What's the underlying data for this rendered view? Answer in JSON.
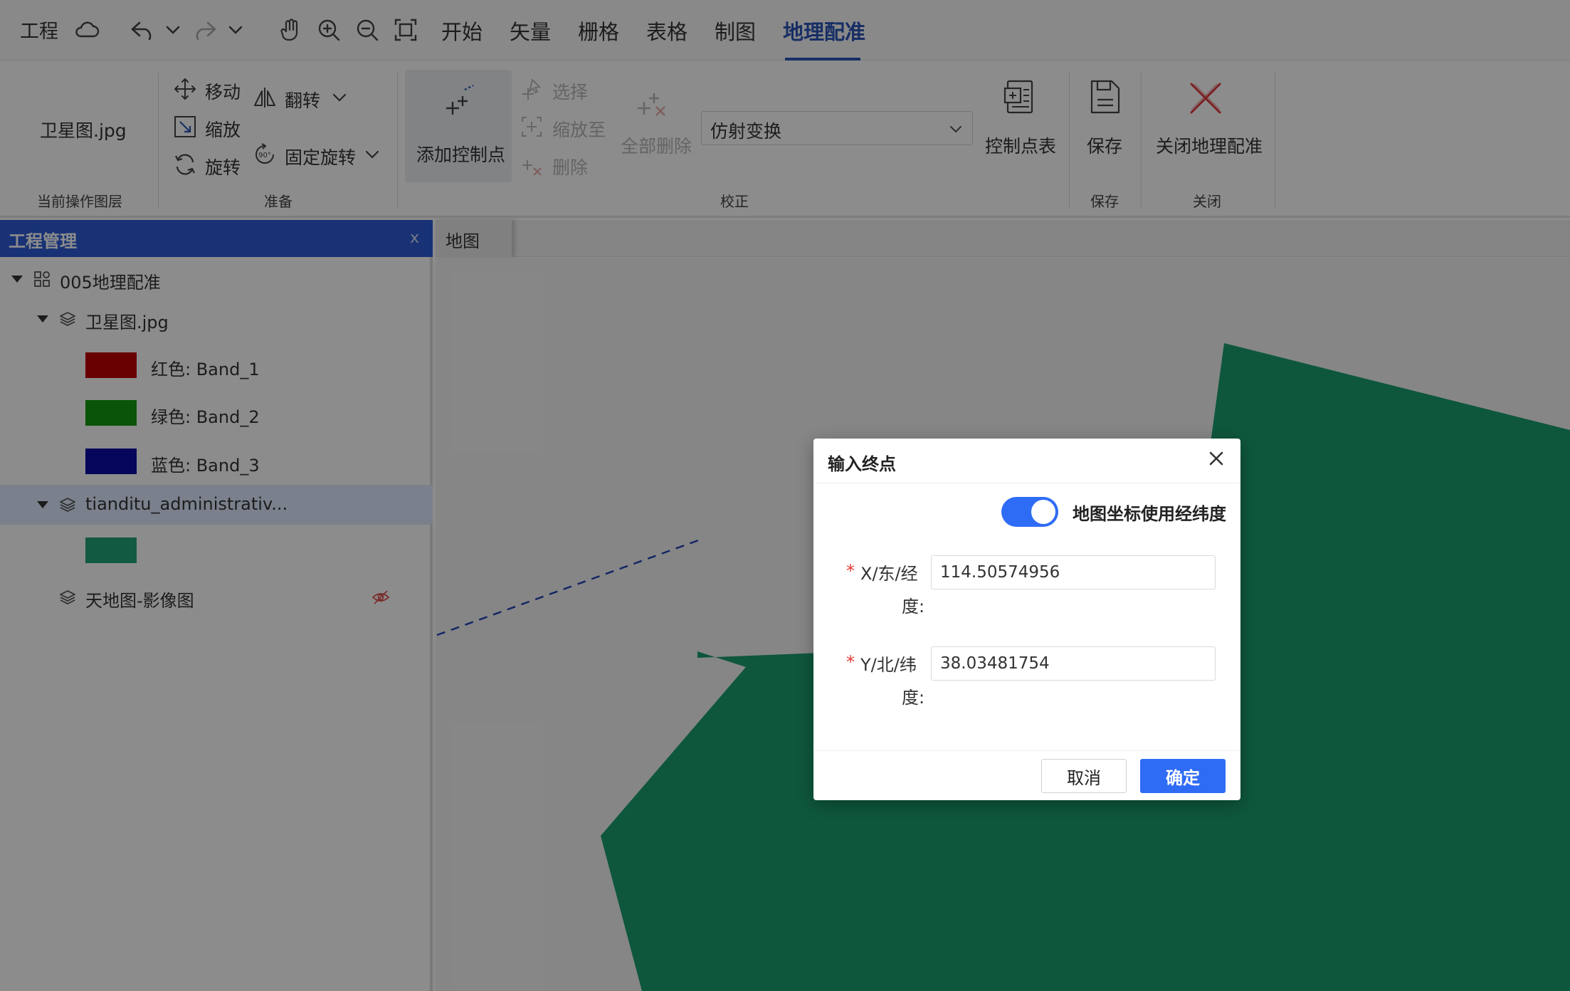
{
  "colors": {
    "accent": "#2a54b8",
    "panel_header": "#2f5bd6",
    "toggle_on": "#2f6cf5",
    "map_polygon": "#1a9e6e",
    "required": "#e53935"
  },
  "menubar": {
    "project": "工程",
    "tabs": [
      {
        "label": "开始",
        "active": false
      },
      {
        "label": "矢量",
        "active": false
      },
      {
        "label": "栅格",
        "active": false
      },
      {
        "label": "表格",
        "active": false
      },
      {
        "label": "制图",
        "active": false
      },
      {
        "label": "地理配准",
        "active": true
      }
    ],
    "icons": [
      "cloud-icon",
      "undo-icon",
      "chevron-down-icon",
      "redo-icon",
      "chevron-down-icon",
      "hand-icon",
      "zoom-in-icon",
      "zoom-out-icon",
      "fit-extent-icon"
    ]
  },
  "ribbon": {
    "current_layer": {
      "value": "卫星图.jpg",
      "group": "当前操作图层"
    },
    "prepare": {
      "move": "移动",
      "scale": "缩放",
      "rotate": "旋转",
      "flip": "翻转",
      "fixed_rotate": "固定旋转",
      "group": "准备"
    },
    "correct": {
      "add_point": "添加控制点",
      "select": "选择",
      "zoom_to": "缩放至",
      "delete": "删除",
      "delete_all": "全部删除",
      "transform_selected": "仿射变换",
      "table": "控制点表",
      "group": "校正"
    },
    "save": {
      "label": "保存",
      "group": "保存"
    },
    "close": {
      "label": "关闭地理配准",
      "group": "关闭"
    }
  },
  "panel": {
    "title": "工程管理",
    "close": "x",
    "tree": {
      "root": "005地理配准",
      "layer1": "卫星图.jpg",
      "band1": "红色: Band_1",
      "band2": "绿色: Band_2",
      "band3": "蓝色: Band_3",
      "layer2": "tianditu_administrativ...",
      "layer3": "天地图-影像图"
    },
    "swatches": {
      "red": "#c00000",
      "green": "#119a11",
      "blue": "#0a0aa5",
      "teal": "#23a57a"
    }
  },
  "map": {
    "tab": "地图"
  },
  "dialog": {
    "title": "输入终点",
    "toggle_label": "地图坐标使用经纬度",
    "toggle_on": true,
    "x_label_line1": "X/东/经",
    "x_label_line2": "度:",
    "x_value": "114.50574956",
    "y_label_line1": "Y/北/纬",
    "y_label_line2": "度:",
    "y_value": "38.03481754",
    "required_mark": "*",
    "cancel": "取消",
    "ok": "确定"
  }
}
